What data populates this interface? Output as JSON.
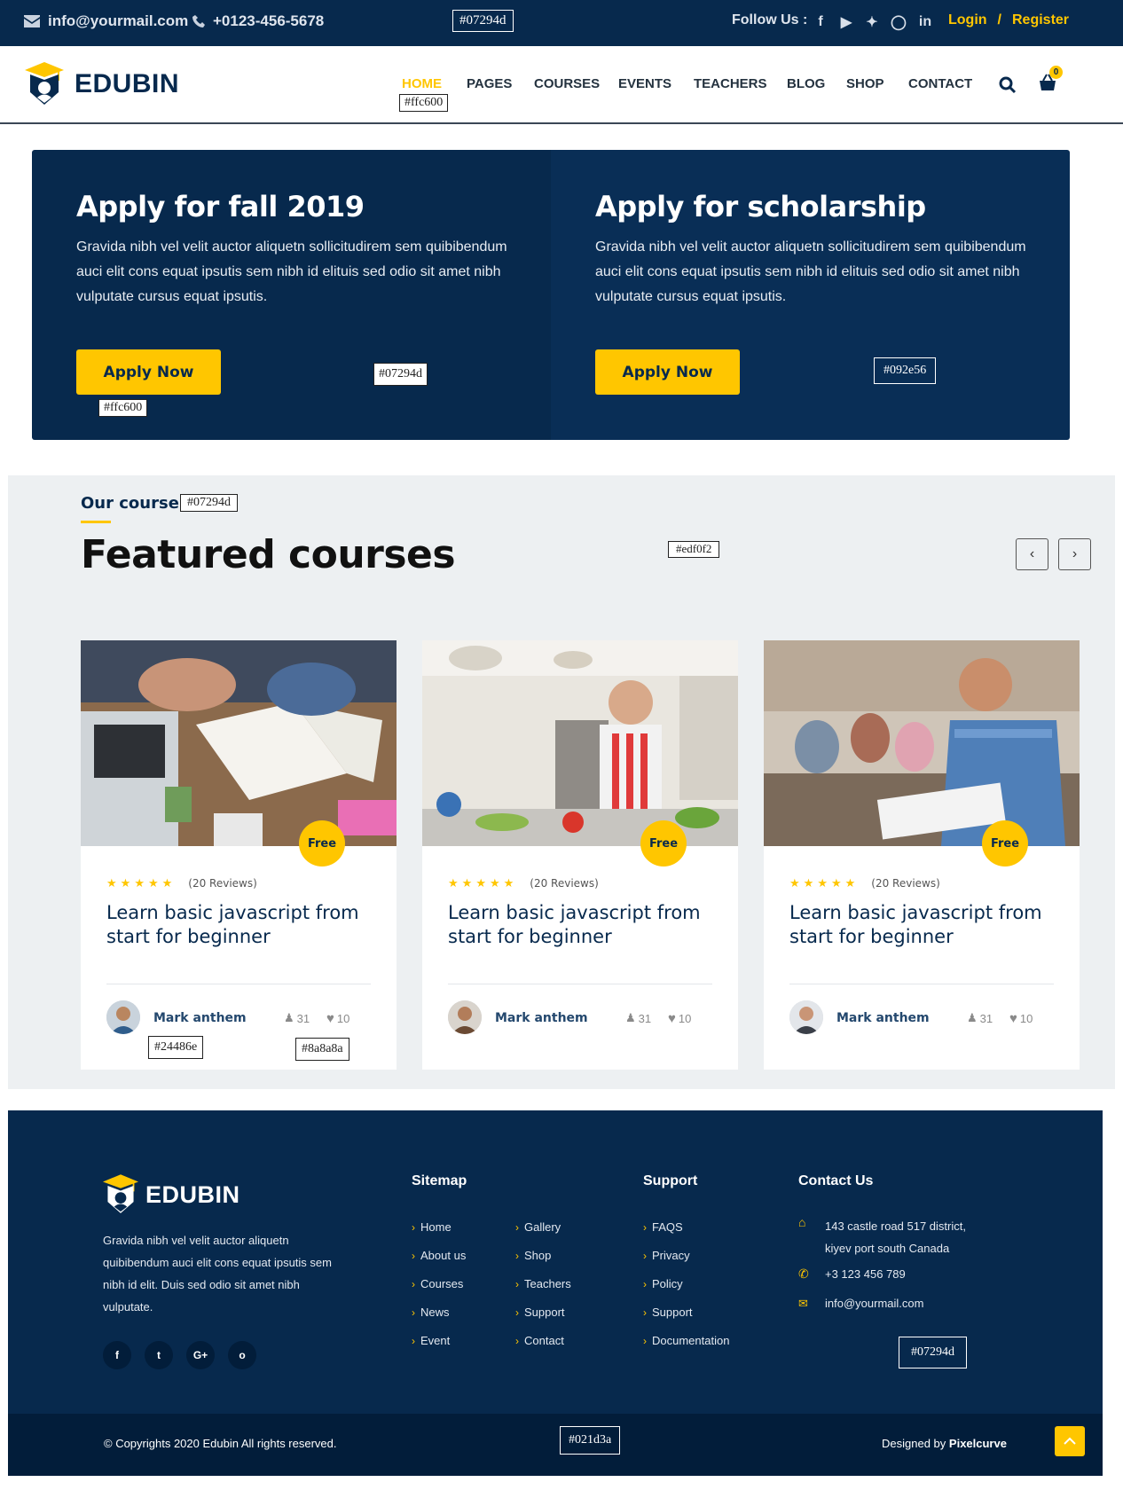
{
  "colors": {
    "primary": "#07294d",
    "accent": "#ffc600",
    "card_dark": "#092e56",
    "section_bg": "#edf0f2",
    "author": "#24486e",
    "meta": "#8a8a8a",
    "footer_bottom": "#021d3a"
  },
  "topbar": {
    "email": "info@yourmail.com",
    "phone": "+0123-456-5678",
    "follow_label": "Follow Us :",
    "social_icons": [
      "facebook-icon",
      "youtube-icon",
      "twitter-icon",
      "instagram-icon",
      "linkedin-icon"
    ],
    "login": "Login",
    "separator": "/",
    "register": "Register"
  },
  "nav": {
    "logo": "EDUBIN",
    "items": [
      "HOME",
      "PAGES",
      "COURSES",
      "EVENTS",
      "TEACHERS",
      "BLOG",
      "SHOP",
      "CONTACT"
    ],
    "cart_count": "0"
  },
  "apply": [
    {
      "title": "Apply for fall 2019",
      "text": "Gravida nibh vel velit auctor aliquetn sollicitudirem sem quibibendum auci elit cons equat ipsutis sem nibh id elituis sed odio sit amet nibh vulputate cursus equat ipsutis.",
      "button": "Apply Now"
    },
    {
      "title": "Apply for scholarship",
      "text": "Gravida nibh vel velit auctor aliquetn sollicitudirem sem quibibendum auci elit cons equat ipsutis sem nibh id elituis sed odio sit amet nibh vulputate cursus equat ipsutis.",
      "button": "Apply Now"
    }
  ],
  "courses": {
    "eyebrow": "Our course",
    "heading": "Featured courses",
    "cards": [
      {
        "badge": "Free",
        "rating": 5,
        "reviews": "(20 Reviews)",
        "title": "Learn basic javascript from start for beginner",
        "author": "Mark anthem",
        "students": "31",
        "likes": "10"
      },
      {
        "badge": "Free",
        "rating": 5,
        "reviews": "(20 Reviews)",
        "title": "Learn basic javascript from start for beginner",
        "author": "Mark anthem",
        "students": "31",
        "likes": "10"
      },
      {
        "badge": "Free",
        "rating": 5,
        "reviews": "(20 Reviews)",
        "title": "Learn basic javascript from start for beginner",
        "author": "Mark anthem",
        "students": "31",
        "likes": "10"
      }
    ]
  },
  "footer": {
    "logo": "EDUBIN",
    "about": "Gravida nibh vel velit auctor aliquetn quibibendum auci elit cons equat ipsutis sem nibh id elit. Duis sed odio sit amet nibh vulputate.",
    "social": [
      "f",
      "t",
      "G+",
      "o"
    ],
    "sitemap_title": "Sitemap",
    "sitemap_col1": [
      "Home",
      "About us",
      "Courses",
      "News",
      "Event"
    ],
    "sitemap_col2": [
      "Gallery",
      "Shop",
      "Teachers",
      "Support",
      "Contact"
    ],
    "support_title": "Support",
    "support": [
      "FAQS",
      "Privacy",
      "Policy",
      "Support",
      "Documentation"
    ],
    "contact_title": "Contact Us",
    "address_line1": "143 castle road 517 district,",
    "address_line2": "kiyev port south Canada",
    "phone": "+3 123 456 789",
    "email": "info@yourmail.com",
    "copyright": "© Copyrights 2020 Edubin All rights reserved.",
    "designed_by": "Designed by",
    "designer": "Pixelcurve"
  },
  "color_labels": {
    "topbar": "#07294d",
    "nav_home": "#ffc600",
    "apply_left": "#07294d",
    "apply_btn": "#ffc600",
    "apply_right": "#092e56",
    "our_course": "#07294d",
    "section_bg": "#edf0f2",
    "author": "#24486e",
    "meta": "#8a8a8a",
    "footer": "#07294d",
    "footer_bottom": "#021d3a"
  }
}
